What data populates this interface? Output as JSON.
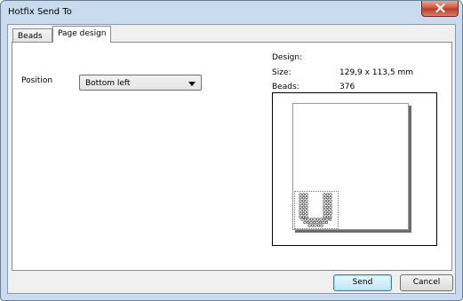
{
  "window": {
    "title": "Hotfix Send To",
    "close_icon": "close-icon"
  },
  "tabs": [
    {
      "label": "Beads",
      "active": false
    },
    {
      "label": "Page design",
      "active": true
    }
  ],
  "position": {
    "label": "Position",
    "selected": "Bottom left"
  },
  "info": {
    "design_label": "Design:",
    "size_label": "Size:",
    "size_value": "129,9 x 113,5 mm",
    "beads_label": "Beads:",
    "beads_value": "376"
  },
  "buttons": {
    "send": "Send",
    "cancel": "Cancel"
  },
  "colors": {
    "frame": "#c9dbee",
    "default_button": "#bee6fd",
    "close_button": "#c9503a"
  }
}
